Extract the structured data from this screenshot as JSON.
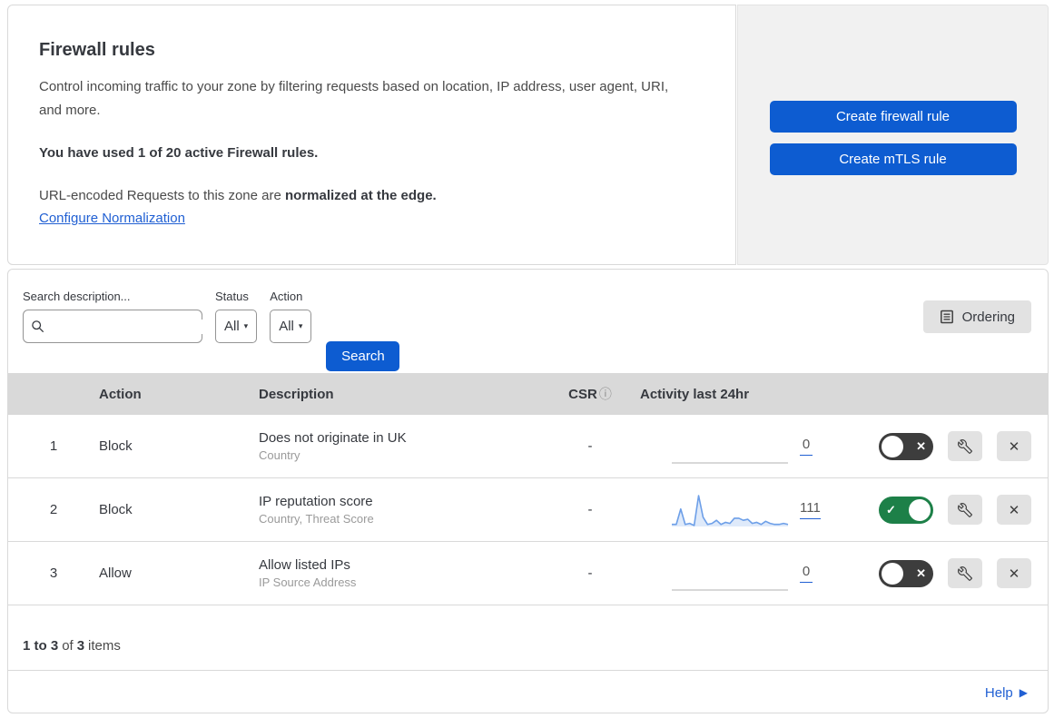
{
  "header": {
    "title": "Firewall rules",
    "description": "Control incoming traffic to your zone by filtering requests based on location, IP address, user agent, URI, and more.",
    "usage": "You have used 1 of 20 active Firewall rules.",
    "normalization_prefix": "URL-encoded Requests to this zone are ",
    "normalization_bold": "normalized at the edge.",
    "configure_link": "Configure Normalization"
  },
  "actions_panel": {
    "create_firewall_label": "Create firewall rule",
    "create_mtls_label": "Create mTLS rule"
  },
  "filters": {
    "search_label": "Search description...",
    "status_label": "Status",
    "status_value": "All",
    "action_label": "Action",
    "action_value": "All",
    "search_button": "Search",
    "ordering_button": "Ordering"
  },
  "table": {
    "columns": {
      "action": "Action",
      "description": "Description",
      "csr": "CSR",
      "activity": "Activity last 24hr"
    },
    "rows": [
      {
        "priority": "1",
        "action": "Block",
        "description": "Does not originate in UK",
        "fields": "Country",
        "csr": "-",
        "count": "0",
        "enabled": false,
        "activity_values": [
          0,
          0,
          0,
          0,
          0,
          0,
          0,
          0,
          0,
          0,
          0,
          0,
          0,
          0,
          0,
          0,
          0,
          0,
          0,
          0,
          0,
          0,
          0,
          0
        ]
      },
      {
        "priority": "2",
        "action": "Block",
        "description": "IP reputation score",
        "fields": "Country, Threat Score",
        "csr": "-",
        "count": "111",
        "enabled": true,
        "activity_values": [
          2,
          2,
          17,
          2,
          3,
          1,
          30,
          9,
          2,
          3,
          6,
          2,
          4,
          3,
          8,
          8,
          6,
          7,
          3,
          4,
          2,
          5,
          3,
          2,
          2,
          3,
          2
        ]
      },
      {
        "priority": "3",
        "action": "Allow",
        "description": "Allow listed IPs",
        "fields": "IP Source Address",
        "csr": "-",
        "count": "0",
        "enabled": false,
        "activity_values": [
          0,
          0,
          0,
          0,
          0,
          0,
          0,
          0,
          0,
          0,
          0,
          0,
          0,
          0,
          0,
          0,
          0,
          0,
          0,
          0,
          0,
          0,
          0,
          0
        ]
      }
    ]
  },
  "footer": {
    "range": "1 to 3",
    "of_label": "of",
    "total": "3",
    "items_label": "items"
  },
  "help": {
    "label": "Help"
  },
  "chart_data": {
    "type": "area",
    "title": "Activity last 24hr sparkline (rule 2)",
    "x": "24 hourly buckets (unlabeled)",
    "values": [
      2,
      2,
      17,
      2,
      3,
      1,
      30,
      9,
      2,
      3,
      6,
      2,
      4,
      3,
      8,
      8,
      6,
      7,
      3,
      4,
      2,
      5,
      3,
      2,
      2,
      3,
      2
    ],
    "total_label": "111",
    "line_color": "#6d9fe8",
    "fill_color": "rgba(109,159,232,0.22)",
    "zero_line_color": "#c0c0c0"
  },
  "colors": {
    "primary_blue": "#0d5cd1",
    "link_blue": "#2160d3",
    "toggle_on_green": "#1d8048",
    "toggle_off_gray": "#3d3d3d",
    "table_header_bg": "#d9d9d9",
    "panel_gray": "#f1f1f1",
    "sparkline_blue": "#6d9fe8"
  }
}
